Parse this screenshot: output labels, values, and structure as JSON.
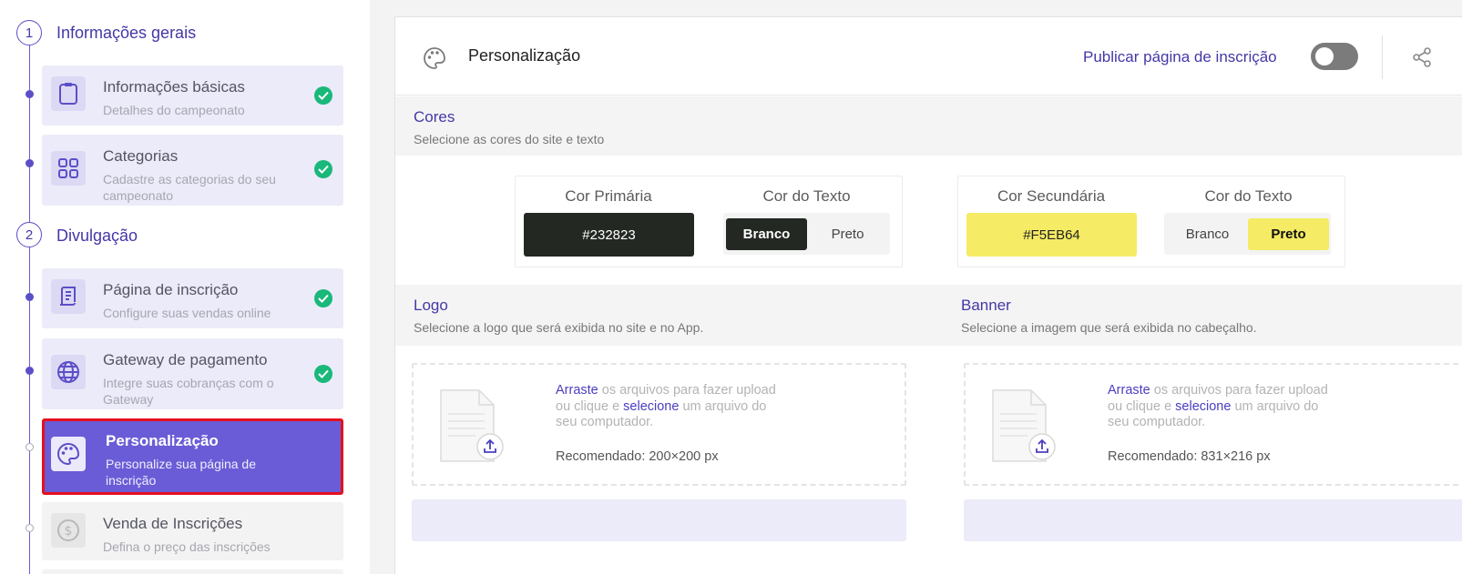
{
  "sidebar": {
    "sections": [
      {
        "number": "1",
        "title": "Informações gerais"
      },
      {
        "number": "2",
        "title": "Divulgação"
      }
    ],
    "items": [
      {
        "title": "Informações básicas",
        "subtitle": "Detalhes do campeonato",
        "status": "complete"
      },
      {
        "title": "Categorias",
        "subtitle": "Cadastre as categorias do seu campeonato",
        "status": "complete"
      },
      {
        "title": "Página de inscrição",
        "subtitle": "Configure suas vendas online",
        "status": "complete"
      },
      {
        "title": "Gateway de pagamento",
        "subtitle": "Integre suas cobranças com o Gateway",
        "status": "complete"
      },
      {
        "title": "Personalização",
        "subtitle": "Personalize sua página de inscrição",
        "status": "active"
      },
      {
        "title": "Venda de Inscrições",
        "subtitle": "Defina o preço das inscrições",
        "status": "pending"
      }
    ]
  },
  "header": {
    "title": "Personalização",
    "publish_label": "Publicar página de inscrição",
    "publish_enabled": false
  },
  "colors_section": {
    "title": "Cores",
    "subtitle": "Selecione as cores do site e texto",
    "primary": {
      "label": "Cor Primária",
      "value": "#232823",
      "text_label": "Cor do Texto",
      "options": [
        "Branco",
        "Preto"
      ],
      "selected": "Branco"
    },
    "secondary": {
      "label": "Cor Secundária",
      "value": "#F5EB64",
      "text_label": "Cor do Texto",
      "options": [
        "Branco",
        "Preto"
      ],
      "selected": "Preto"
    }
  },
  "logo_section": {
    "title": "Logo",
    "subtitle": "Selecione a logo que será exibida no site e no App.",
    "drop_link1": "Arraste",
    "drop_text1": " os arquivos para fazer upload ou clique e ",
    "drop_link2": "selecione",
    "drop_text2": " um arquivo do seu computador.",
    "recommended": "Recomendado: 200×200 px"
  },
  "banner_section": {
    "title": "Banner",
    "subtitle": "Selecione a imagem que será exibida no cabeçalho.",
    "drop_link1": "Arraste",
    "drop_text1": " os arquivos para fazer upload ou clique e ",
    "drop_link2": "selecione",
    "drop_text2": " um arquivo do seu computador.",
    "recommended": "Recomendado: 831×216 px"
  },
  "theme": {
    "accent": "#4338a7",
    "active_bg": "#6a5cd6",
    "success": "#1ab87a",
    "highlight_border": "#e60f1e"
  }
}
